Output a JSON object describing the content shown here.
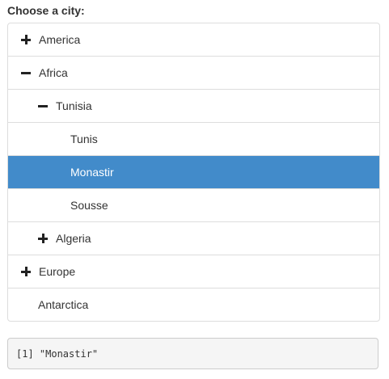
{
  "label": "Choose a city:",
  "tree": {
    "nodes": [
      {
        "text": "America",
        "toggle": "plus"
      },
      {
        "text": "Africa",
        "toggle": "minus"
      },
      {
        "text": "Tunisia",
        "toggle": "minus"
      },
      {
        "text": "Tunis"
      },
      {
        "text": "Monastir",
        "selected": true
      },
      {
        "text": "Sousse"
      },
      {
        "text": "Algeria",
        "toggle": "plus"
      },
      {
        "text": "Europe",
        "toggle": "plus"
      },
      {
        "text": "Antarctica"
      }
    ]
  },
  "output": {
    "text": "[1] \"Monastir\""
  },
  "colors": {
    "selected_bg": "#428bca",
    "border": "#dddddd",
    "output_bg": "#f5f5f5"
  }
}
